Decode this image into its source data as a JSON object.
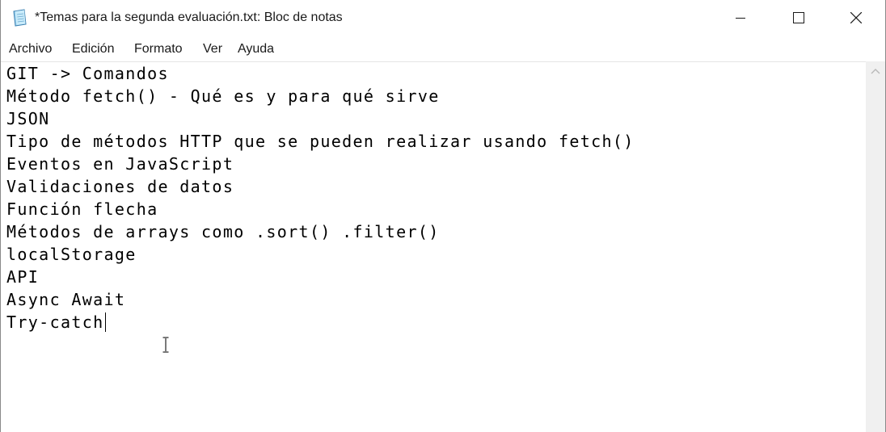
{
  "window": {
    "title": "*Temas para la segunda evaluación.txt: Bloc de notas",
    "app_icon": "notepad-icon",
    "controls": [
      "minimize-icon",
      "maximize-icon",
      "close-icon"
    ]
  },
  "menu": {
    "items": [
      {
        "label": "Archivo"
      },
      {
        "label": "Edición"
      },
      {
        "label": "Formato"
      },
      {
        "label": "Ver"
      },
      {
        "label": "Ayuda"
      }
    ]
  },
  "editor": {
    "lines": [
      "GIT -> Comandos",
      "Método fetch() - Qué es y para qué sirve",
      "JSON",
      "Tipo de métodos HTTP que se pueden realizar usando fetch()",
      "Eventos en JavaScript",
      "Validaciones de datos",
      "Función flecha",
      "Métodos de arrays como .sort() .filter()",
      "localStorage",
      "API",
      "Async Await",
      "Try-catch"
    ]
  },
  "colors": {
    "text": "#000000",
    "scrollbar_track": "#f0f0f0",
    "background": "#ffffff"
  }
}
